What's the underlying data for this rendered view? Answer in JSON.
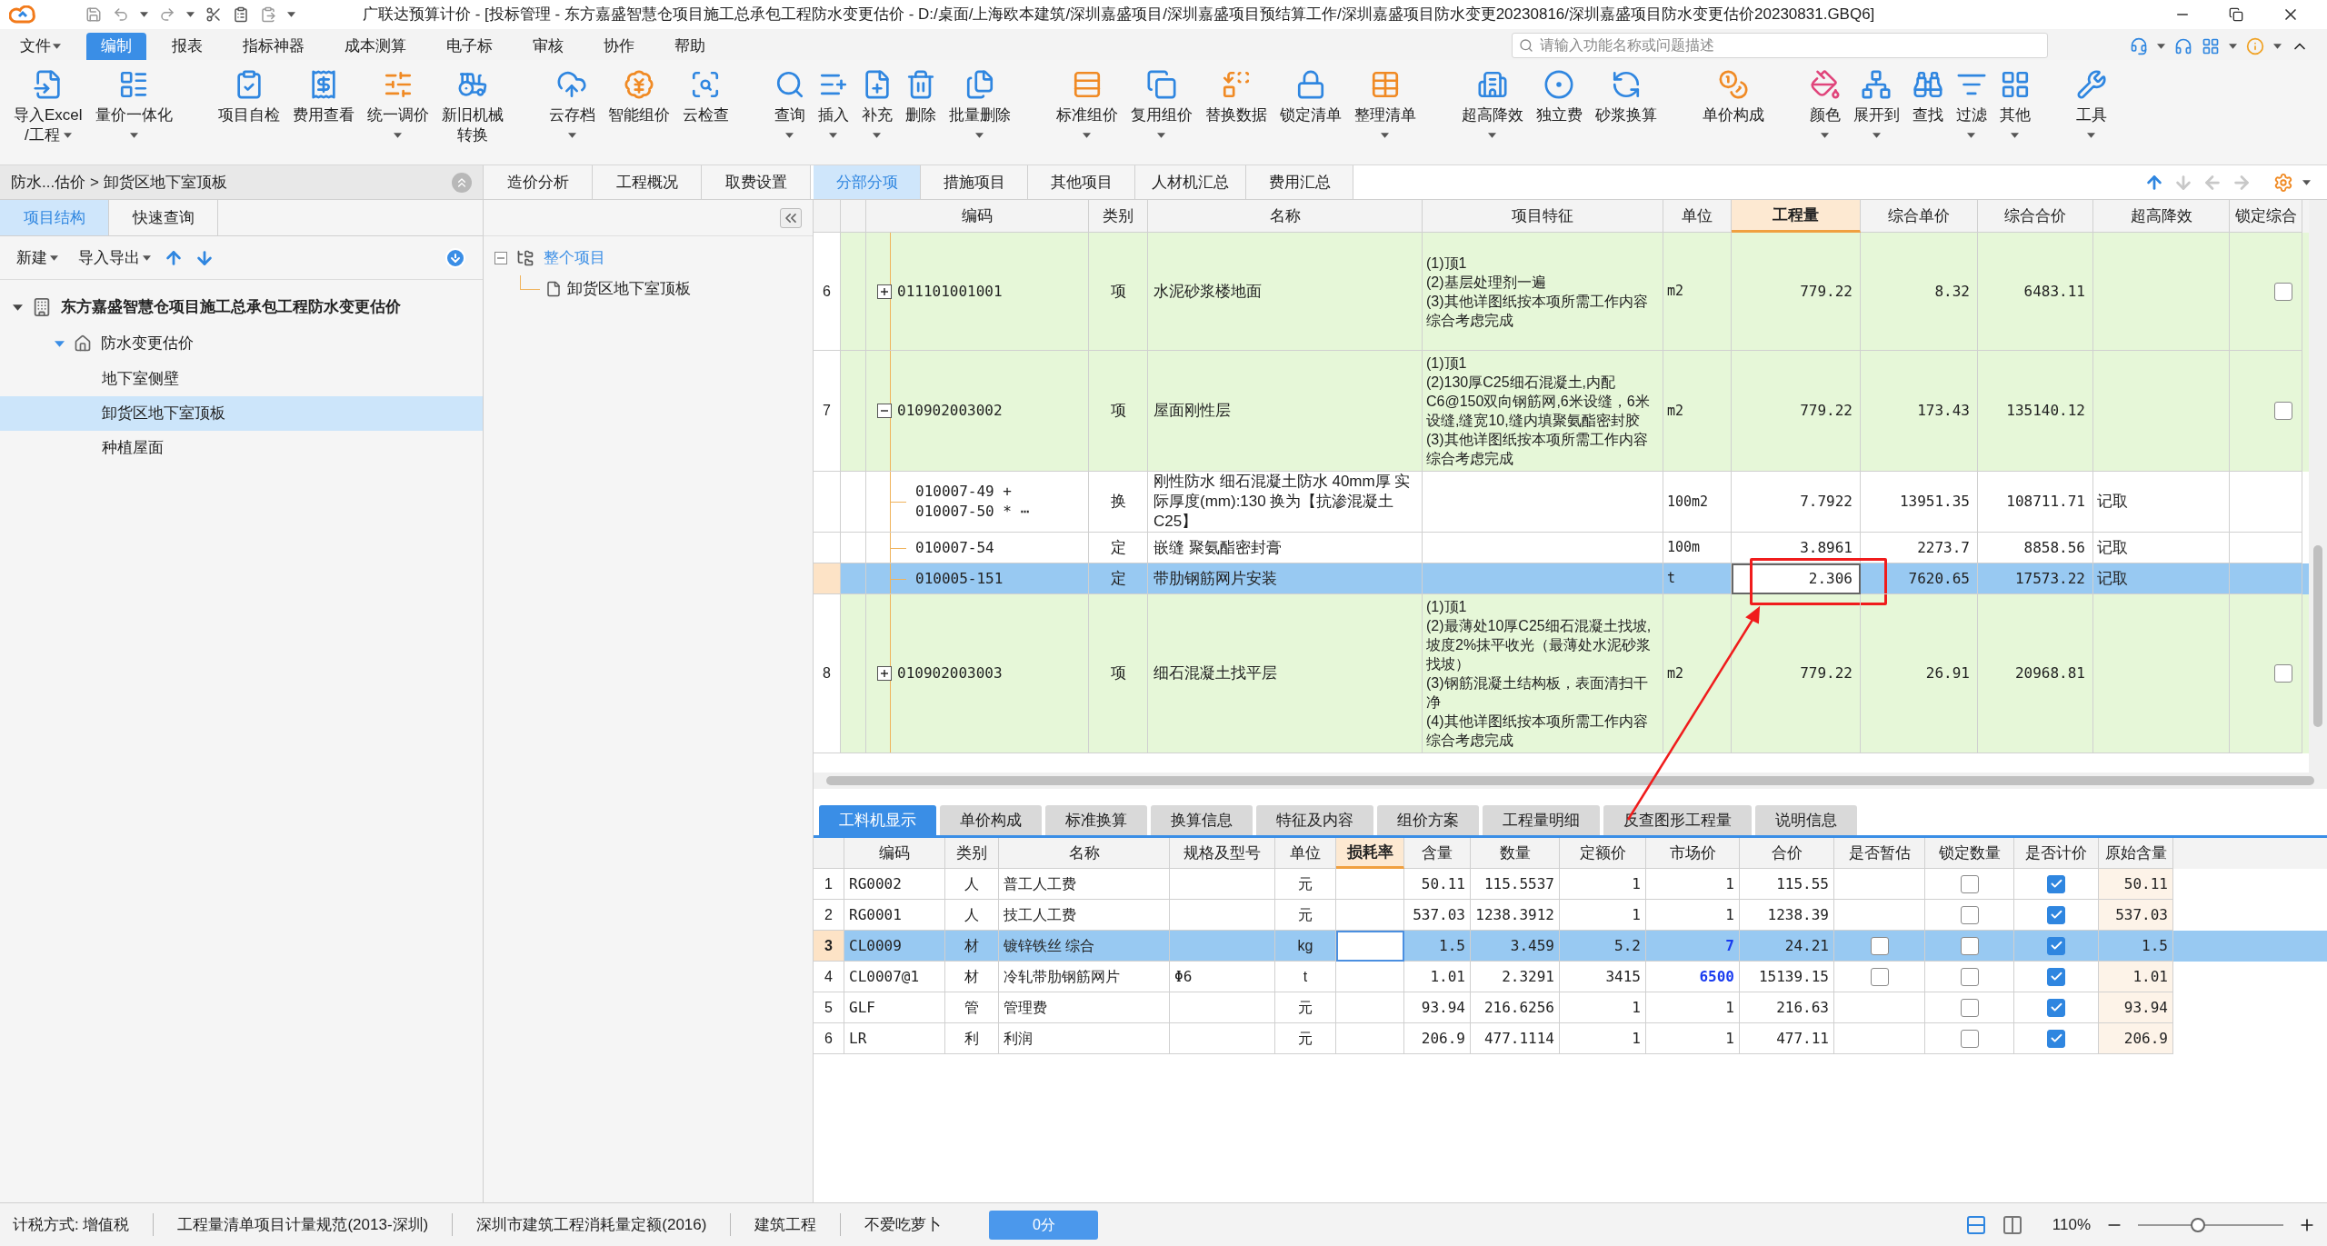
{
  "window": {
    "title": "广联达预算计价 - [投标管理 - 东方嘉盛智慧仓项目施工总承包工程防水变更估价 - D:/桌面/上海欧本建筑/深圳嘉盛项目/深圳嘉盛项目预结算工作/深圳嘉盛项目防水变更20230816/深圳嘉盛项目防水变更估价20230831.GBQ6]"
  },
  "menu": [
    {
      "label": "文件",
      "dropdown": true,
      "selected": false
    },
    {
      "label": "编制",
      "dropdown": false,
      "selected": true
    },
    {
      "label": "报表",
      "dropdown": false,
      "selected": false
    },
    {
      "label": "指标神器",
      "dropdown": false,
      "selected": false
    },
    {
      "label": "成本测算",
      "dropdown": false,
      "selected": false
    },
    {
      "label": "电子标",
      "dropdown": false,
      "selected": false
    },
    {
      "label": "审核",
      "dropdown": false,
      "selected": false
    },
    {
      "label": "协作",
      "dropdown": false,
      "selected": false
    },
    {
      "label": "帮助",
      "dropdown": false,
      "selected": false
    }
  ],
  "search": {
    "placeholder": "请输入功能名称或问题描述"
  },
  "toolbar_groups": [
    {
      "buttons": [
        {
          "lines": [
            "导入Excel",
            "/工程"
          ],
          "dropdown": true
        },
        {
          "lines": [
            "量价一体化"
          ],
          "dropdown": true
        }
      ]
    },
    {
      "buttons": [
        {
          "lines": [
            "项目自检"
          ],
          "dropdown": false
        },
        {
          "lines": [
            "费用查看"
          ],
          "dropdown": false
        },
        {
          "lines": [
            "统一调价"
          ],
          "dropdown": true
        },
        {
          "lines": [
            "新旧机械",
            "转换"
          ],
          "dropdown": false
        }
      ]
    },
    {
      "buttons": [
        {
          "lines": [
            "云存档"
          ],
          "dropdown": true
        },
        {
          "lines": [
            "智能组价"
          ],
          "dropdown": false
        },
        {
          "lines": [
            "云检查"
          ],
          "dropdown": false
        }
      ]
    },
    {
      "buttons": [
        {
          "lines": [
            "查询"
          ],
          "dropdown": true
        },
        {
          "lines": [
            "插入"
          ],
          "dropdown": true
        },
        {
          "lines": [
            "补充"
          ],
          "dropdown": true
        },
        {
          "lines": [
            "删除"
          ],
          "dropdown": false
        },
        {
          "lines": [
            "批量删除"
          ],
          "dropdown": true
        }
      ]
    },
    {
      "buttons": [
        {
          "lines": [
            "标准组价"
          ],
          "dropdown": true
        },
        {
          "lines": [
            "复用组价"
          ],
          "dropdown": true
        },
        {
          "lines": [
            "替换数据"
          ],
          "dropdown": false
        },
        {
          "lines": [
            "锁定清单"
          ],
          "dropdown": false
        },
        {
          "lines": [
            "整理清单"
          ],
          "dropdown": true
        }
      ]
    },
    {
      "buttons": [
        {
          "lines": [
            "超高降效"
          ],
          "dropdown": true
        },
        {
          "lines": [
            "独立费"
          ],
          "dropdown": false
        },
        {
          "lines": [
            "砂浆换算"
          ],
          "dropdown": false
        }
      ]
    },
    {
      "buttons": [
        {
          "lines": [
            "单价构成"
          ],
          "dropdown": false
        }
      ]
    },
    {
      "buttons": [
        {
          "lines": [
            "颜色"
          ],
          "dropdown": true
        },
        {
          "lines": [
            "展开到"
          ],
          "dropdown": true
        },
        {
          "lines": [
            "查找"
          ],
          "dropdown": false
        },
        {
          "lines": [
            "过滤"
          ],
          "dropdown": true
        },
        {
          "lines": [
            "其他"
          ],
          "dropdown": true
        }
      ]
    },
    {
      "buttons": [
        {
          "lines": [
            "工具"
          ],
          "dropdown": true
        }
      ]
    }
  ],
  "left_panel": {
    "breadcrumb": "防水...估价 > 卸货区地下室顶板",
    "tabs": [
      {
        "label": "项目结构",
        "selected": true
      },
      {
        "label": "快速查询",
        "selected": false
      }
    ],
    "actions": [
      {
        "label": "新建"
      },
      {
        "label": "导入导出"
      }
    ],
    "tree": [
      {
        "label": "东方嘉盛智慧仓项目施工总承包工程防水变更估价",
        "expanded": true,
        "children": [
          {
            "label": "防水变更估价",
            "expanded": true,
            "children": [
              {
                "label": "地下室侧壁",
                "selected": false
              },
              {
                "label": "卸货区地下室顶板",
                "selected": true
              },
              {
                "label": "种植屋面",
                "selected": false
              }
            ]
          }
        ]
      }
    ]
  },
  "view_tabs": [
    {
      "label": "造价分析",
      "selected": false
    },
    {
      "label": "工程概况",
      "selected": false
    },
    {
      "label": "取费设置",
      "selected": false
    }
  ],
  "main_tabs": [
    {
      "label": "分部分项",
      "selected": true
    },
    {
      "label": "措施项目",
      "selected": false
    },
    {
      "label": "其他项目",
      "selected": false
    },
    {
      "label": "人材机汇总",
      "selected": false
    },
    {
      "label": "费用汇总",
      "selected": false
    }
  ],
  "table_nav": [
    {
      "disabled": false
    },
    {
      "disabled": true
    },
    {
      "disabled": true
    },
    {
      "disabled": true
    }
  ],
  "middle_tree": {
    "label": "整个项目",
    "expanded": true,
    "children": [
      {
        "label": "卸货区地下室顶板"
      }
    ]
  },
  "main_table": {
    "columns": [
      {
        "label": "编码",
        "highlighted": false
      },
      {
        "label": "类别",
        "highlighted": false
      },
      {
        "label": "名称",
        "highlighted": false
      },
      {
        "label": "项目特征",
        "highlighted": false
      },
      {
        "label": "单位",
        "highlighted": false
      },
      {
        "label": "工程量",
        "highlighted": true
      },
      {
        "label": "综合单价",
        "highlighted": false
      },
      {
        "label": "综合合价",
        "highlighted": false
      },
      {
        "label": "超高降效",
        "highlighted": false
      },
      {
        "label": "锁定综合",
        "highlighted": false
      }
    ],
    "rows": [
      {
        "kind": "item",
        "no": "6",
        "expanded": false,
        "code": "011101001001",
        "type": "项",
        "name": "水泥砂浆楼地面",
        "features": [
          "(1)顶1",
          "(2)基层处理剂一遍",
          "(3)其他详图纸按本项所需工作内容综合考虑完成"
        ],
        "unit": "m2",
        "qty": "779.22",
        "unit_price": "8.32",
        "total": "6483.11",
        "locked": false,
        "selected": false
      },
      {
        "kind": "item",
        "no": "7",
        "expanded": true,
        "code": "010902003002",
        "type": "项",
        "name": "屋面刚性层",
        "features": [
          "(1)顶1",
          "(2)130厚C25细石混凝土,内配C6@150双向钢筋网,6米设缝，6米设缝,缝宽10,缝内填聚氨酯密封胶",
          "(3)其他详图纸按本项所需工作内容综合考虑完成"
        ],
        "unit": "m2",
        "qty": "779.22",
        "unit_price": "173.43",
        "total": "135140.12",
        "locked": false,
        "selected": false
      },
      {
        "kind": "sub",
        "code": "010007-49 + 010007-50 * ⋯",
        "type": "换",
        "name": "刚性防水 细石混凝土防水 40mm厚  实际厚度(mm):130  换为【抗渗混凝土 C25】",
        "unit": "100m2",
        "qty": "7.7922",
        "unit_price": "13951.35",
        "total": "108711.71",
        "extra": "记取",
        "selected": false
      },
      {
        "kind": "sub",
        "code": "010007-54",
        "type": "定",
        "name": "嵌缝 聚氨酯密封膏",
        "unit": "100m",
        "qty": "3.8961",
        "unit_price": "2273.7",
        "total": "8858.56",
        "extra": "记取",
        "selected": false
      },
      {
        "kind": "sub",
        "code": "010005-151",
        "type": "定",
        "name": "带肋钢筋网片安装",
        "unit": "t",
        "qty": "2.306",
        "unit_price": "7620.65",
        "total": "17573.22",
        "extra": "记取",
        "selected": true
      },
      {
        "kind": "item",
        "no": "8",
        "expanded": false,
        "code": "010902003003",
        "type": "项",
        "name": "细石混凝土找平层",
        "features": [
          "(1)顶1",
          "(2)最薄处10厚C25细石混凝土找坡,坡度2%抹平收光（最薄处水泥砂浆找坡）",
          "(3)钢筋混凝土结构板，表面清扫干净",
          "(4)其他详图纸按本项所需工作内容综合考虑完成"
        ],
        "unit": "m2",
        "qty": "779.22",
        "unit_price": "26.91",
        "total": "20968.81",
        "locked": false,
        "selected": false
      }
    ]
  },
  "detail_tabs": [
    {
      "label": "工料机显示",
      "selected": true
    },
    {
      "label": "单价构成",
      "selected": false
    },
    {
      "label": "标准换算",
      "selected": false
    },
    {
      "label": "换算信息",
      "selected": false
    },
    {
      "label": "特征及内容",
      "selected": false
    },
    {
      "label": "组价方案",
      "selected": false
    },
    {
      "label": "工程量明细",
      "selected": false
    },
    {
      "label": "反查图形工程量",
      "selected": false
    },
    {
      "label": "说明信息",
      "selected": false
    }
  ],
  "detail_table": {
    "columns": [
      {
        "label": "编码",
        "highlighted": false
      },
      {
        "label": "类别",
        "highlighted": false
      },
      {
        "label": "名称",
        "highlighted": false
      },
      {
        "label": "规格及型号",
        "highlighted": false
      },
      {
        "label": "单位",
        "highlighted": false
      },
      {
        "label": "损耗率",
        "highlighted": true
      },
      {
        "label": "含量",
        "highlighted": false
      },
      {
        "label": "数量",
        "highlighted": false
      },
      {
        "label": "定额价",
        "highlighted": false
      },
      {
        "label": "市场价",
        "highlighted": false
      },
      {
        "label": "合价",
        "highlighted": false
      },
      {
        "label": "是否暂估",
        "highlighted": false
      },
      {
        "label": "锁定数量",
        "highlighted": false
      },
      {
        "label": "是否计价",
        "highlighted": false
      },
      {
        "label": "原始含量",
        "highlighted": false
      }
    ],
    "rows": [
      {
        "no": "1",
        "code": "RG0002",
        "type": "人",
        "name": "普工人工费",
        "unit": "元",
        "content": "50.11",
        "qty": "115.5537",
        "quota_price": "1",
        "market_price": "1",
        "modified": false,
        "total": "115.55",
        "lock_qty": false,
        "priced": true,
        "original": "50.11",
        "selected": false
      },
      {
        "no": "2",
        "code": "RG0001",
        "type": "人",
        "name": "技工人工费",
        "unit": "元",
        "content": "537.03",
        "qty": "1238.3912",
        "quota_price": "1",
        "market_price": "1",
        "modified": false,
        "total": "1238.39",
        "lock_qty": false,
        "priced": true,
        "original": "537.03",
        "selected": false
      },
      {
        "no": "3",
        "code": "CL0009",
        "type": "材",
        "name": "镀锌铁丝 综合",
        "unit": "kg",
        "content": "1.5",
        "qty": "3.459",
        "quota_price": "5.2",
        "market_price": "7",
        "modified": true,
        "total": "24.21",
        "provisional": false,
        "lock_qty": false,
        "priced": true,
        "original": "1.5",
        "selected": true
      },
      {
        "no": "4",
        "code": "CL0007@1",
        "type": "材",
        "name": "冷轧带肋钢筋网片",
        "spec": "Φ6",
        "unit": "t",
        "content": "1.01",
        "qty": "2.3291",
        "quota_price": "3415",
        "market_price": "6500",
        "modified": true,
        "total": "15139.15",
        "provisional": false,
        "lock_qty": false,
        "priced": true,
        "original": "1.01",
        "selected": false
      },
      {
        "no": "5",
        "code": "GLF",
        "type": "管",
        "name": "管理费",
        "unit": "元",
        "content": "93.94",
        "qty": "216.6256",
        "quota_price": "1",
        "market_price": "1",
        "modified": false,
        "total": "216.63",
        "lock_qty": false,
        "priced": true,
        "original": "93.94",
        "selected": false
      },
      {
        "no": "6",
        "code": "LR",
        "type": "利",
        "name": "利润",
        "unit": "元",
        "content": "206.9",
        "qty": "477.1114",
        "quota_price": "1",
        "market_price": "1",
        "modified": false,
        "total": "477.11",
        "lock_qty": false,
        "priced": true,
        "original": "206.9",
        "selected": false
      }
    ]
  },
  "status_bar": {
    "items": [
      "计税方式: 增值税",
      "工程量清单项目计量规范(2013-深圳)",
      "深圳市建筑工程消耗量定额(2016)",
      "建筑工程",
      "不爱吃萝卜"
    ],
    "score_button": "0分",
    "views": [
      {
        "selected": true
      },
      {
        "selected": false
      }
    ],
    "zoom": "110%",
    "zoom_slider": {
      "level": 0.41
    }
  }
}
